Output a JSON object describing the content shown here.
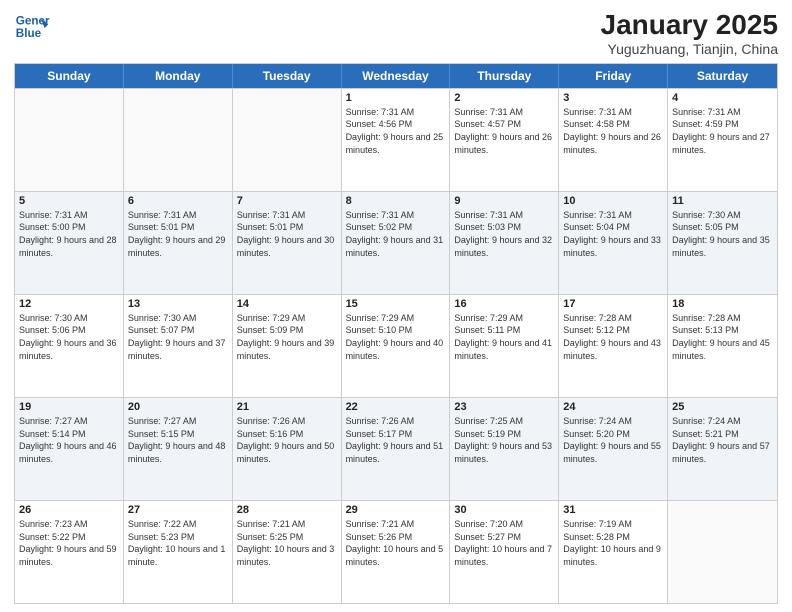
{
  "header": {
    "logo_line1": "General",
    "logo_line2": "Blue",
    "month_year": "January 2025",
    "location": "Yuguzhuang, Tianjin, China"
  },
  "weekdays": [
    "Sunday",
    "Monday",
    "Tuesday",
    "Wednesday",
    "Thursday",
    "Friday",
    "Saturday"
  ],
  "rows": [
    [
      {
        "day": "",
        "sunrise": "",
        "sunset": "",
        "daylight": ""
      },
      {
        "day": "",
        "sunrise": "",
        "sunset": "",
        "daylight": ""
      },
      {
        "day": "",
        "sunrise": "",
        "sunset": "",
        "daylight": ""
      },
      {
        "day": "1",
        "sunrise": "Sunrise: 7:31 AM",
        "sunset": "Sunset: 4:56 PM",
        "daylight": "Daylight: 9 hours and 25 minutes."
      },
      {
        "day": "2",
        "sunrise": "Sunrise: 7:31 AM",
        "sunset": "Sunset: 4:57 PM",
        "daylight": "Daylight: 9 hours and 26 minutes."
      },
      {
        "day": "3",
        "sunrise": "Sunrise: 7:31 AM",
        "sunset": "Sunset: 4:58 PM",
        "daylight": "Daylight: 9 hours and 26 minutes."
      },
      {
        "day": "4",
        "sunrise": "Sunrise: 7:31 AM",
        "sunset": "Sunset: 4:59 PM",
        "daylight": "Daylight: 9 hours and 27 minutes."
      }
    ],
    [
      {
        "day": "5",
        "sunrise": "Sunrise: 7:31 AM",
        "sunset": "Sunset: 5:00 PM",
        "daylight": "Daylight: 9 hours and 28 minutes."
      },
      {
        "day": "6",
        "sunrise": "Sunrise: 7:31 AM",
        "sunset": "Sunset: 5:01 PM",
        "daylight": "Daylight: 9 hours and 29 minutes."
      },
      {
        "day": "7",
        "sunrise": "Sunrise: 7:31 AM",
        "sunset": "Sunset: 5:01 PM",
        "daylight": "Daylight: 9 hours and 30 minutes."
      },
      {
        "day": "8",
        "sunrise": "Sunrise: 7:31 AM",
        "sunset": "Sunset: 5:02 PM",
        "daylight": "Daylight: 9 hours and 31 minutes."
      },
      {
        "day": "9",
        "sunrise": "Sunrise: 7:31 AM",
        "sunset": "Sunset: 5:03 PM",
        "daylight": "Daylight: 9 hours and 32 minutes."
      },
      {
        "day": "10",
        "sunrise": "Sunrise: 7:31 AM",
        "sunset": "Sunset: 5:04 PM",
        "daylight": "Daylight: 9 hours and 33 minutes."
      },
      {
        "day": "11",
        "sunrise": "Sunrise: 7:30 AM",
        "sunset": "Sunset: 5:05 PM",
        "daylight": "Daylight: 9 hours and 35 minutes."
      }
    ],
    [
      {
        "day": "12",
        "sunrise": "Sunrise: 7:30 AM",
        "sunset": "Sunset: 5:06 PM",
        "daylight": "Daylight: 9 hours and 36 minutes."
      },
      {
        "day": "13",
        "sunrise": "Sunrise: 7:30 AM",
        "sunset": "Sunset: 5:07 PM",
        "daylight": "Daylight: 9 hours and 37 minutes."
      },
      {
        "day": "14",
        "sunrise": "Sunrise: 7:29 AM",
        "sunset": "Sunset: 5:09 PM",
        "daylight": "Daylight: 9 hours and 39 minutes."
      },
      {
        "day": "15",
        "sunrise": "Sunrise: 7:29 AM",
        "sunset": "Sunset: 5:10 PM",
        "daylight": "Daylight: 9 hours and 40 minutes."
      },
      {
        "day": "16",
        "sunrise": "Sunrise: 7:29 AM",
        "sunset": "Sunset: 5:11 PM",
        "daylight": "Daylight: 9 hours and 41 minutes."
      },
      {
        "day": "17",
        "sunrise": "Sunrise: 7:28 AM",
        "sunset": "Sunset: 5:12 PM",
        "daylight": "Daylight: 9 hours and 43 minutes."
      },
      {
        "day": "18",
        "sunrise": "Sunrise: 7:28 AM",
        "sunset": "Sunset: 5:13 PM",
        "daylight": "Daylight: 9 hours and 45 minutes."
      }
    ],
    [
      {
        "day": "19",
        "sunrise": "Sunrise: 7:27 AM",
        "sunset": "Sunset: 5:14 PM",
        "daylight": "Daylight: 9 hours and 46 minutes."
      },
      {
        "day": "20",
        "sunrise": "Sunrise: 7:27 AM",
        "sunset": "Sunset: 5:15 PM",
        "daylight": "Daylight: 9 hours and 48 minutes."
      },
      {
        "day": "21",
        "sunrise": "Sunrise: 7:26 AM",
        "sunset": "Sunset: 5:16 PM",
        "daylight": "Daylight: 9 hours and 50 minutes."
      },
      {
        "day": "22",
        "sunrise": "Sunrise: 7:26 AM",
        "sunset": "Sunset: 5:17 PM",
        "daylight": "Daylight: 9 hours and 51 minutes."
      },
      {
        "day": "23",
        "sunrise": "Sunrise: 7:25 AM",
        "sunset": "Sunset: 5:19 PM",
        "daylight": "Daylight: 9 hours and 53 minutes."
      },
      {
        "day": "24",
        "sunrise": "Sunrise: 7:24 AM",
        "sunset": "Sunset: 5:20 PM",
        "daylight": "Daylight: 9 hours and 55 minutes."
      },
      {
        "day": "25",
        "sunrise": "Sunrise: 7:24 AM",
        "sunset": "Sunset: 5:21 PM",
        "daylight": "Daylight: 9 hours and 57 minutes."
      }
    ],
    [
      {
        "day": "26",
        "sunrise": "Sunrise: 7:23 AM",
        "sunset": "Sunset: 5:22 PM",
        "daylight": "Daylight: 9 hours and 59 minutes."
      },
      {
        "day": "27",
        "sunrise": "Sunrise: 7:22 AM",
        "sunset": "Sunset: 5:23 PM",
        "daylight": "Daylight: 10 hours and 1 minute."
      },
      {
        "day": "28",
        "sunrise": "Sunrise: 7:21 AM",
        "sunset": "Sunset: 5:25 PM",
        "daylight": "Daylight: 10 hours and 3 minutes."
      },
      {
        "day": "29",
        "sunrise": "Sunrise: 7:21 AM",
        "sunset": "Sunset: 5:26 PM",
        "daylight": "Daylight: 10 hours and 5 minutes."
      },
      {
        "day": "30",
        "sunrise": "Sunrise: 7:20 AM",
        "sunset": "Sunset: 5:27 PM",
        "daylight": "Daylight: 10 hours and 7 minutes."
      },
      {
        "day": "31",
        "sunrise": "Sunrise: 7:19 AM",
        "sunset": "Sunset: 5:28 PM",
        "daylight": "Daylight: 10 hours and 9 minutes."
      },
      {
        "day": "",
        "sunrise": "",
        "sunset": "",
        "daylight": ""
      }
    ]
  ]
}
